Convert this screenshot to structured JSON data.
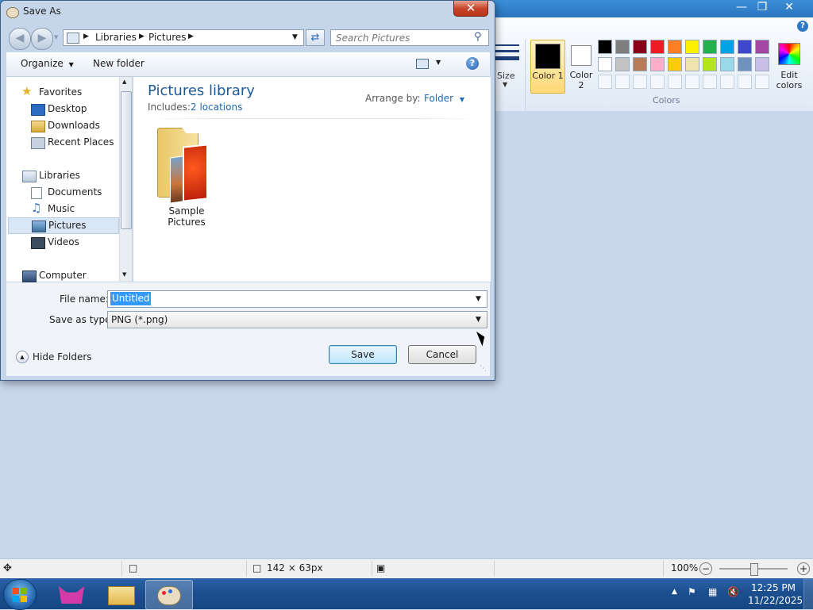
{
  "dialog": {
    "title": "Save As",
    "breadcrumb": [
      "Libraries",
      "Pictures"
    ],
    "search_placeholder": "Search Pictures",
    "toolbar": {
      "organize": "Organize",
      "new_folder": "New folder"
    },
    "nav": {
      "favorites": "Favorites",
      "favorites_items": [
        "Desktop",
        "Downloads",
        "Recent Places"
      ],
      "libraries": "Libraries",
      "libraries_items": [
        "Documents",
        "Music",
        "Pictures",
        "Videos"
      ],
      "computer": "Computer",
      "selected": "Pictures"
    },
    "library": {
      "title": "Pictures library",
      "includes_label": "Includes:",
      "includes_link": "2 locations",
      "arrange_label": "Arrange by:",
      "arrange_value": "Folder"
    },
    "items": [
      {
        "name": "Sample Pictures"
      }
    ],
    "file_name_label": "File name:",
    "file_name_value": "Untitled",
    "save_type_label": "Save as type:",
    "save_type_value": "PNG (*.png)",
    "hide_folders": "Hide Folders",
    "save_button": "Save",
    "cancel_button": "Cancel"
  },
  "paint": {
    "size_label": "Size",
    "color1_label": "Color 1",
    "color2_label": "Color 2",
    "edit_colors_label": "Edit colors",
    "colors_group_label": "Colors",
    "palette_row1": [
      "#000000",
      "#7f7f7f",
      "#880015",
      "#ed1c24",
      "#ff7f27",
      "#fff200",
      "#22b14c",
      "#00a2e8",
      "#3f48cc",
      "#a349a4"
    ],
    "palette_row2": [
      "#ffffff",
      "#c3c3c3",
      "#b97a57",
      "#ffaec9",
      "#ffc90e",
      "#efe4b0",
      "#b5e61d",
      "#99d9ea",
      "#7092be",
      "#c8bfe7"
    ],
    "status": {
      "selection_size": "142 × 63px",
      "zoom": "100%"
    }
  },
  "taskbar": {
    "time": "12:25 PM",
    "date": "11/22/2025"
  }
}
